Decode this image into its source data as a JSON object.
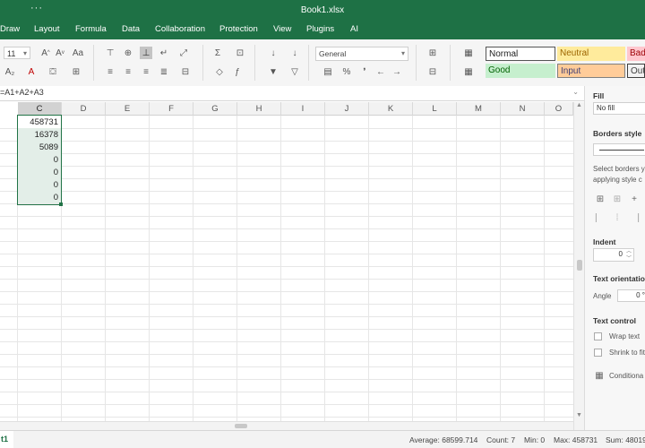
{
  "window": {
    "title": "Book1.xlsx",
    "more_label": "···"
  },
  "menu": [
    "Draw",
    "Layout",
    "Formula",
    "Data",
    "Collaboration",
    "Protection",
    "View",
    "Plugins",
    "AI"
  ],
  "toolbar": {
    "font_size": "11",
    "number_format": "General",
    "styles": {
      "normal": "Normal",
      "neutral": "Neutral",
      "bad": "Bad",
      "good": "Good",
      "input": "Input",
      "output": "Out"
    },
    "colors": {
      "normal_bg": "#ffffff",
      "neutral_bg": "#ffeb9c",
      "bad_bg": "#ffc7ce",
      "good_bg": "#c6efce",
      "input_bg": "#ffcc99",
      "output_bg": "#f2f2f2"
    }
  },
  "formula_bar": {
    "text": "=A1+A2+A3"
  },
  "grid": {
    "columns": [
      "C",
      "D",
      "E",
      "F",
      "G",
      "H",
      "I",
      "J",
      "K",
      "L",
      "M",
      "N",
      "O"
    ],
    "selected_column": "C",
    "values": [
      "458731",
      "16378",
      "5089",
      "0",
      "0",
      "0",
      "0"
    ]
  },
  "status_bar": {
    "sheet_tab": "t1",
    "average": "Average: 68599.714",
    "count": "Count: 7",
    "min": "Min: 0",
    "max": "Max: 458731",
    "sum": "Sum: 48019"
  },
  "panel": {
    "fill_title": "Fill",
    "fill_value": "No fill",
    "borders_title": "Borders style",
    "borders_hint_1": "Select borders y",
    "borders_hint_2": "applying style c",
    "indent_title": "Indent",
    "indent_value": "0",
    "orientation_title": "Text orientation",
    "angle_label": "Angle",
    "angle_value": "0 °",
    "control_title": "Text control",
    "wrap_label": "Wrap text",
    "shrink_label": "Shrink to fit",
    "conditional_label": "Conditiona"
  },
  "accent": "#1e7145"
}
